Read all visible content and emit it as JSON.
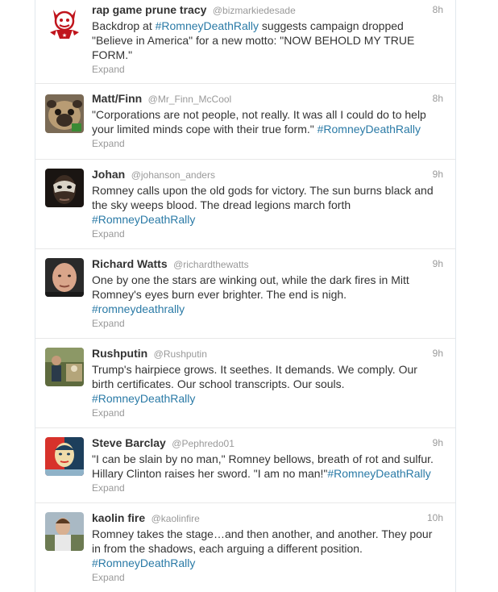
{
  "tweets": [
    {
      "fullname": "rap game prune tracy",
      "username": "@bizmarkiedesade",
      "time": "8h",
      "lines": [
        {
          "pre": "Backdrop at ",
          "tag": "#RomneyDeathRally",
          "post": " suggests campaign dropped"
        },
        {
          "pre": "\"Believe in America\" for a new motto: \"NOW BEHOLD MY TRUE",
          "tag": "",
          "post": ""
        },
        {
          "pre": "FORM.\"",
          "tag": "",
          "post": ""
        }
      ],
      "expand": "Expand",
      "avatar_icon": "devil-cartoon-avatar"
    },
    {
      "fullname": "Matt/Finn",
      "username": "@Mr_Finn_McCool",
      "time": "8h",
      "lines": [
        {
          "pre": "\"Corporations are not people, not really. It was all I could do to help",
          "tag": "",
          "post": ""
        },
        {
          "pre": "your limited minds cope with their true form.\" ",
          "tag": "#RomneyDeathRally",
          "post": ""
        }
      ],
      "expand": "Expand",
      "avatar_icon": "pug-avatar"
    },
    {
      "fullname": "Johan",
      "username": "@johanson_anders",
      "time": "9h",
      "lines": [
        {
          "pre": "Romney calls upon the old gods for victory. The sun burns black and",
          "tag": "",
          "post": ""
        },
        {
          "pre": "the sky weeps blood. The dread legions march forth",
          "tag": "",
          "post": ""
        },
        {
          "pre": "",
          "tag": "#RomneyDeathRally",
          "post": ""
        }
      ],
      "expand": "Expand",
      "avatar_icon": "masked-face-avatar"
    },
    {
      "fullname": "Richard Watts",
      "username": "@richardthewatts",
      "time": "9h",
      "lines": [
        {
          "pre": "One by one the stars are winking out, while the dark fires in Mitt",
          "tag": "",
          "post": ""
        },
        {
          "pre": "Romney's eyes burn ever brighter. The end is nigh.",
          "tag": "",
          "post": ""
        },
        {
          "pre": "",
          "tag": "#romneydeathrally",
          "post": ""
        }
      ],
      "expand": "Expand",
      "avatar_icon": "bald-man-avatar"
    },
    {
      "fullname": "Rushputin",
      "username": "@Rushputin",
      "time": "9h",
      "lines": [
        {
          "pre": "Trump's hairpiece grows. It seethes. It demands. We comply. Our",
          "tag": "",
          "post": ""
        },
        {
          "pre": "birth certificates. Our school transcripts. Our souls.",
          "tag": "",
          "post": ""
        },
        {
          "pre": "",
          "tag": "#RomneyDeathRally",
          "post": ""
        }
      ],
      "expand": "Expand",
      "avatar_icon": "person-outdoors-avatar"
    },
    {
      "fullname": "Steve Barclay",
      "username": "@Pephredo01",
      "time": "9h",
      "lines": [
        {
          "pre": "\"I can be slain by no man,\" Romney bellows, breath of rot and sulfur.",
          "tag": "",
          "post": ""
        },
        {
          "pre": "Hillary Clinton raises her sword. \"I am no man!\"",
          "tag": "#RomneyDeathRally",
          "post": ""
        }
      ],
      "expand": "Expand",
      "avatar_icon": "poster-portrait-avatar"
    },
    {
      "fullname": "kaolin fire",
      "username": "@kaolinfire",
      "time": "10h",
      "lines": [
        {
          "pre": "Romney takes the stage…and then another, and another. They pour",
          "tag": "",
          "post": ""
        },
        {
          "pre": "in from the shadows, each arguing a different position.",
          "tag": "",
          "post": ""
        },
        {
          "pre": "",
          "tag": "#RomneyDeathRally",
          "post": ""
        }
      ],
      "expand": "Expand",
      "avatar_icon": "man-outdoors-avatar"
    }
  ]
}
